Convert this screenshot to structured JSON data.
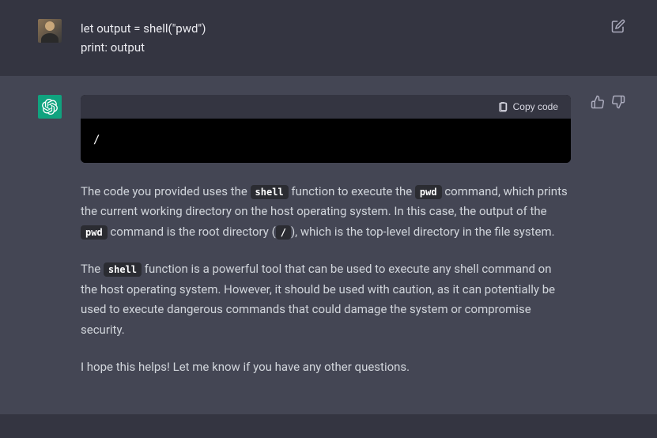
{
  "user_message": "let output = shell(\"pwd\")\nprint: output",
  "assistant": {
    "code_block": {
      "copy_label": "Copy code",
      "content": "/"
    },
    "para1_pre": "The code you provided uses the ",
    "code_shell": "shell",
    "para1_mid1": " function to execute the ",
    "code_pwd": "pwd",
    "para1_mid2": " command, which prints the current working directory on the host operating system. In this case, the output of the ",
    "para1_mid3": " command is the root directory (",
    "code_slash": "/",
    "para1_end": "), which is the top-level directory in the file system.",
    "para2_pre": "The ",
    "para2_rest": " function is a powerful tool that can be used to execute any shell command on the host operating system. However, it should be used with caution, as it can potentially be used to execute dangerous commands that could damage the system or compromise security.",
    "para3": "I hope this helps! Let me know if you have any other questions."
  }
}
